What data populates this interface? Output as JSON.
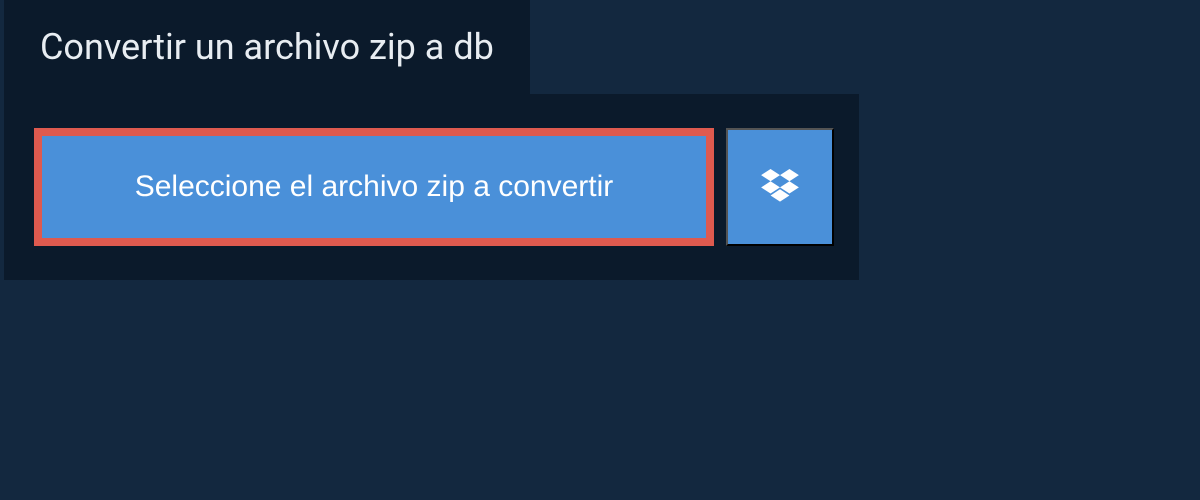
{
  "header": {
    "title": "Convertir un archivo zip a db"
  },
  "actions": {
    "select_file_label": "Seleccione el archivo zip a convertir",
    "dropbox_icon": "dropbox-icon"
  },
  "colors": {
    "page_bg": "#13283f",
    "panel_bg": "#0b1a2b",
    "button_bg": "#4a90d9",
    "highlight_border": "#de5a4f",
    "text_light": "#e8edf2"
  }
}
